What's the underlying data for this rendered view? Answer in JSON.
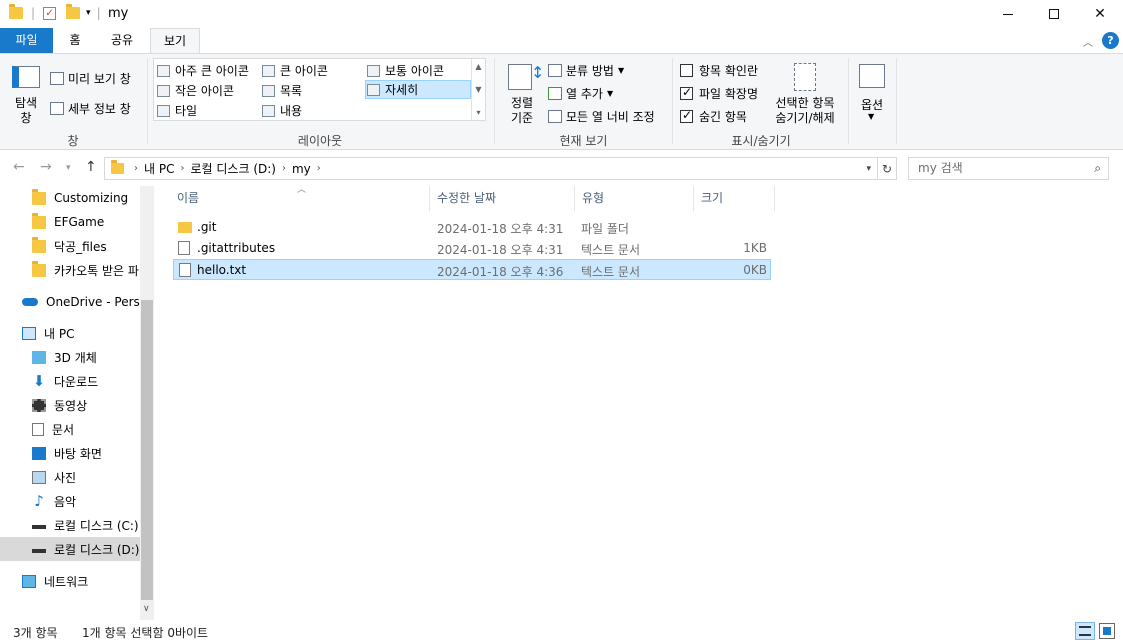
{
  "window": {
    "title": "my",
    "minimize_icon": "minimize-icon",
    "maximize_icon": "maximize-icon",
    "close_icon": "close-icon"
  },
  "ribbon_tabs": {
    "file": "파일",
    "home": "홈",
    "share": "공유",
    "view": "보기"
  },
  "ribbon": {
    "pane_group": {
      "label": "창",
      "nav_pane": "탐색\n창",
      "preview_pane": "미리 보기 창",
      "details_pane": "세부 정보 창"
    },
    "layout_group": {
      "label": "레이아웃",
      "items": [
        "아주 큰 아이콘",
        "큰 아이콘",
        "보통 아이콘",
        "작은 아이콘",
        "목록",
        "자세히",
        "타일",
        "내용"
      ],
      "selected": "자세히"
    },
    "current_view_group": {
      "label": "현재 보기",
      "sort": "정렬\n기준",
      "group_by": "분류 방법",
      "add_column": "열 추가",
      "fit_columns": "모든 열 너비 조정"
    },
    "show_hide_group": {
      "label": "표시/숨기기",
      "item_checkboxes": "항목 확인란",
      "file_extensions": "파일 확장명",
      "hidden_items": "숨긴 항목",
      "hide_selected": "선택한 항목\n숨기기/해제",
      "item_checkboxes_checked": false,
      "file_extensions_checked": true,
      "hidden_items_checked": true
    },
    "options": "옵션"
  },
  "address": {
    "crumbs": [
      "내 PC",
      "로컬 디스크 (D:)",
      "my"
    ],
    "search_placeholder": "my 검색"
  },
  "nav_pane": {
    "items": [
      {
        "label": "Customizing",
        "icon": "folder-icon"
      },
      {
        "label": "EFGame",
        "icon": "folder-icon"
      },
      {
        "label": "닥공_files",
        "icon": "folder-icon"
      },
      {
        "label": "카카오톡 받은 파",
        "icon": "folder-icon"
      },
      {
        "label": "OneDrive - Person",
        "icon": "cloud-icon"
      },
      {
        "label": "내 PC",
        "icon": "pc-icon"
      },
      {
        "label": "3D 개체",
        "icon": "cube-icon"
      },
      {
        "label": "다운로드",
        "icon": "download-icon"
      },
      {
        "label": "동영상",
        "icon": "video-icon"
      },
      {
        "label": "문서",
        "icon": "document-icon"
      },
      {
        "label": "바탕 화면",
        "icon": "desktop-icon"
      },
      {
        "label": "사진",
        "icon": "picture-icon"
      },
      {
        "label": "음악",
        "icon": "music-icon"
      },
      {
        "label": "로컬 디스크 (C:)",
        "icon": "drive-icon"
      },
      {
        "label": "로컬 디스크 (D:)",
        "icon": "drive-icon"
      },
      {
        "label": "네트워크",
        "icon": "network-icon"
      }
    ]
  },
  "file_list": {
    "columns": [
      "이름",
      "수정한 날짜",
      "유형",
      "크기"
    ],
    "rows": [
      {
        "name": ".git",
        "modified": "2024-01-18 오후 4:31",
        "type": "파일 폴더",
        "size": "",
        "icon": "folder-icon"
      },
      {
        "name": ".gitattributes",
        "modified": "2024-01-18 오후 4:31",
        "type": "텍스트 문서",
        "size": "1KB",
        "icon": "text-file-icon"
      },
      {
        "name": "hello.txt",
        "modified": "2024-01-18 오후 4:36",
        "type": "텍스트 문서",
        "size": "0KB",
        "icon": "text-file-icon"
      }
    ]
  },
  "status": {
    "count": "3개 항목",
    "selection": "1개 항목 선택함 0바이트"
  },
  "colors": {
    "accent": "#1979ca",
    "selection": "#cce8ff",
    "folder": "#f5c742"
  }
}
